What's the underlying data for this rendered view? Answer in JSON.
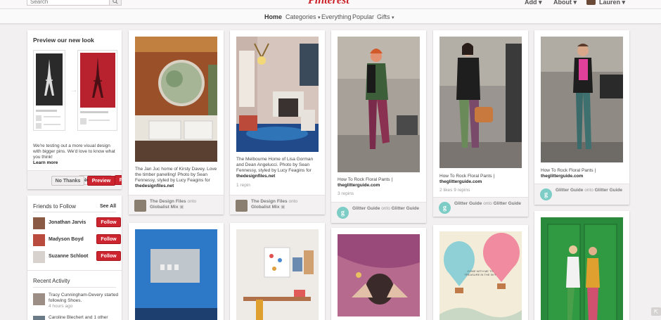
{
  "topbar": {
    "search_placeholder": "Search",
    "logo": "Pinterest",
    "add": "Add",
    "about": "About",
    "user": "Lauren"
  },
  "subnav": {
    "home": "Home",
    "categories": "Categories",
    "everything": "Everything",
    "popular": "Popular",
    "gifts": "Gifts"
  },
  "sidebar": {
    "preview": {
      "title": "Preview our new look",
      "text": "We're testing out a more visual design with bigger pins. We'd love to know what you think!",
      "learn_more": "Learn more",
      "no_thanks": "No Thanks",
      "preview_btn": "Preview"
    },
    "friends": {
      "title": "Friends to Follow",
      "see_all": "See All",
      "follow_label": "Follow",
      "items": [
        {
          "name": "Jonathan Jarvis"
        },
        {
          "name": "Madyson Boyd"
        },
        {
          "name": "Suzanne Schloot"
        }
      ]
    },
    "activity": {
      "title": "Recent Activity",
      "items": [
        {
          "text": "Tracy Cunningham-Devery started following Shoes.",
          "time": "4 hours ago"
        },
        {
          "text": "Caroline Blechert and 1 other",
          "time": ""
        }
      ]
    }
  },
  "pins": [
    {
      "desc": "The Jan Juc home of Kirsty Davey. Love the timber panelling! Photo by Sean Fennessy, styled by Lucy Feagins for",
      "source": "thedesignfiles.net",
      "stats": "",
      "pinner": "The Design Files",
      "board": "Globalist Mix"
    },
    {
      "desc": "The Melbourne Home of Lisa Gorman and Dean Angelucci. Photo by Sean Fennessy, styled by Lucy Feagins for",
      "source": "thedesignfiles.net",
      "stats": "1 repin",
      "pinner": "The Design Files",
      "board": "Globalist Mix"
    },
    {
      "desc": "How To Rock Floral Pants |",
      "source": "theglitterguide.com",
      "stats": "3 repins",
      "pinner": "Glitter Guide",
      "board": "Glitter Guide"
    },
    {
      "desc": "How To Rock Floral Pants |",
      "source": "theglitterguide.com",
      "stats": "2 likes   9 repins",
      "pinner": "Glitter Guide",
      "board": "Glitter Guide"
    },
    {
      "desc": "How To Rock Floral Pants |",
      "source": "theglitterguide.com",
      "stats": "",
      "pinner": "Glitter Guide",
      "board": "Glitter Guide"
    }
  ],
  "attr_onto": "onto",
  "balloon_text": "COME WITH ME TO TREASURE IN THE SKY",
  "colors": {
    "brand_red": "#cb2027",
    "follow_red": "#cd2530",
    "glitter_teal": "#7dccc6"
  },
  "icons": [
    "search-icon",
    "caret-down-icon",
    "arrow-right-icon",
    "board-icon",
    "scroll-top-icon"
  ]
}
